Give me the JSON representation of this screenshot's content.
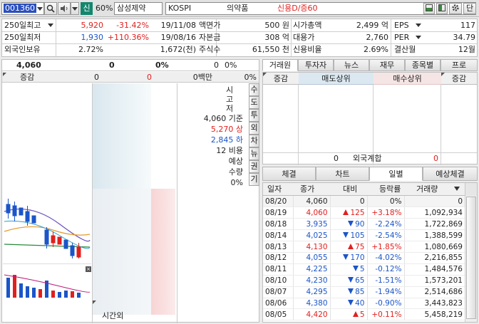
{
  "toolbar": {
    "code": "001360",
    "stock_name": "삼성제약",
    "check_label": "신",
    "rate": "60%",
    "market": "KOSPI",
    "sector": "의약품",
    "credit": "신용D/증60",
    "right_btn": "단"
  },
  "info": {
    "r1": {
      "l1": "250일최고",
      "v1": "5,920",
      "v2": "-31.42%",
      "d1": "19/11/08",
      "l2": "액면가",
      "v3": "500 원",
      "l3": "시가총액",
      "v4": "2,499 억",
      "l4": "EPS",
      "v5": "117"
    },
    "r2": {
      "l1": "250일최저",
      "v1": "1,930",
      "v2": "+110.36%",
      "d1": "19/08/16",
      "l2": "자본금",
      "v3": "308 억",
      "l3": "대용가",
      "v4": "2,760",
      "l4": "PER",
      "v5": "34.79"
    },
    "r3": {
      "l1": "외국인보유",
      "v1": "2.72%",
      "v2": "1,672(천)",
      "l2": "주식수",
      "v3": "61,550 천",
      "l3": "신용비율",
      "v4": "2.69%",
      "l4": "결산월",
      "v5": "12월"
    }
  },
  "order": {
    "price": "4,060",
    "v0": "0",
    "pct": "0%",
    "qty": "0",
    "pct2": "0%",
    "label_change": "증감",
    "c1": "0",
    "c2": "0",
    "amount": "0백만",
    "pct3": "0%"
  },
  "mid": {
    "jeo_chars": [
      "시",
      "고",
      "저"
    ],
    "base_val": "4,060",
    "base_lbl": "기준",
    "up_val": "5,270",
    "up_lbl": "상",
    "dn_val": "2,845",
    "dn_lbl": "하",
    "rate_val": "12",
    "rate_lbl": "비용",
    "exp_lbl": "예상",
    "qty_lbl": "수량",
    "exp_pct": "0%",
    "after_hours": "시간외"
  },
  "side_buttons": [
    "수",
    "도",
    "투",
    "외",
    "차",
    "뉴",
    "권",
    "기"
  ],
  "right": {
    "tabs": [
      "거래원",
      "투자자",
      "뉴스",
      "재무",
      "종목별",
      "프로"
    ],
    "hdr": {
      "chg": "증감",
      "sell": "매도상위",
      "buy": "매수상위",
      "chg2": "증감"
    },
    "foreign": {
      "left": "0",
      "label": "외국계합",
      "right": "0"
    },
    "tabs2": [
      "체결",
      "차트",
      "일별",
      "예상체결"
    ],
    "cols": [
      "일자",
      "종가",
      "대비",
      "등락률",
      "거래량"
    ],
    "rows": [
      {
        "date": "08/20",
        "close": "4,060",
        "dir": "none",
        "diff": "0",
        "rate": "0%",
        "vol": "0",
        "c": "black"
      },
      {
        "date": "08/19",
        "close": "4,060",
        "dir": "up",
        "diff": "125",
        "rate": "+3.18%",
        "vol": "1,092,934",
        "c": "red"
      },
      {
        "date": "08/18",
        "close": "3,935",
        "dir": "down",
        "diff": "90",
        "rate": "-2.24%",
        "vol": "1,722,869",
        "c": "blue"
      },
      {
        "date": "08/14",
        "close": "4,025",
        "dir": "down",
        "diff": "105",
        "rate": "-2.54%",
        "vol": "1,388,599",
        "c": "blue"
      },
      {
        "date": "08/13",
        "close": "4,130",
        "dir": "up",
        "diff": "75",
        "rate": "+1.85%",
        "vol": "1,080,669",
        "c": "red"
      },
      {
        "date": "08/12",
        "close": "4,055",
        "dir": "down",
        "diff": "170",
        "rate": "-4.02%",
        "vol": "2,216,855",
        "c": "blue"
      },
      {
        "date": "08/11",
        "close": "4,225",
        "dir": "down",
        "diff": "5",
        "rate": "-0.12%",
        "vol": "1,484,576",
        "c": "blue"
      },
      {
        "date": "08/10",
        "close": "4,230",
        "dir": "down",
        "diff": "65",
        "rate": "-1.51%",
        "vol": "1,573,201",
        "c": "blue"
      },
      {
        "date": "08/07",
        "close": "4,295",
        "dir": "down",
        "diff": "85",
        "rate": "-1.94%",
        "vol": "2,514,686",
        "c": "blue"
      },
      {
        "date": "08/06",
        "close": "4,380",
        "dir": "down",
        "diff": "40",
        "rate": "-0.90%",
        "vol": "3,443,823",
        "c": "blue"
      },
      {
        "date": "08/05",
        "close": "4,420",
        "dir": "up",
        "diff": "5",
        "rate": "+0.11%",
        "vol": "5,458,219",
        "c": "red"
      }
    ]
  },
  "colors": {
    "up": "#e0201e",
    "down": "#1b55c8",
    "code_bg": "#2a4fbf",
    "check_bg": "#14866e"
  }
}
